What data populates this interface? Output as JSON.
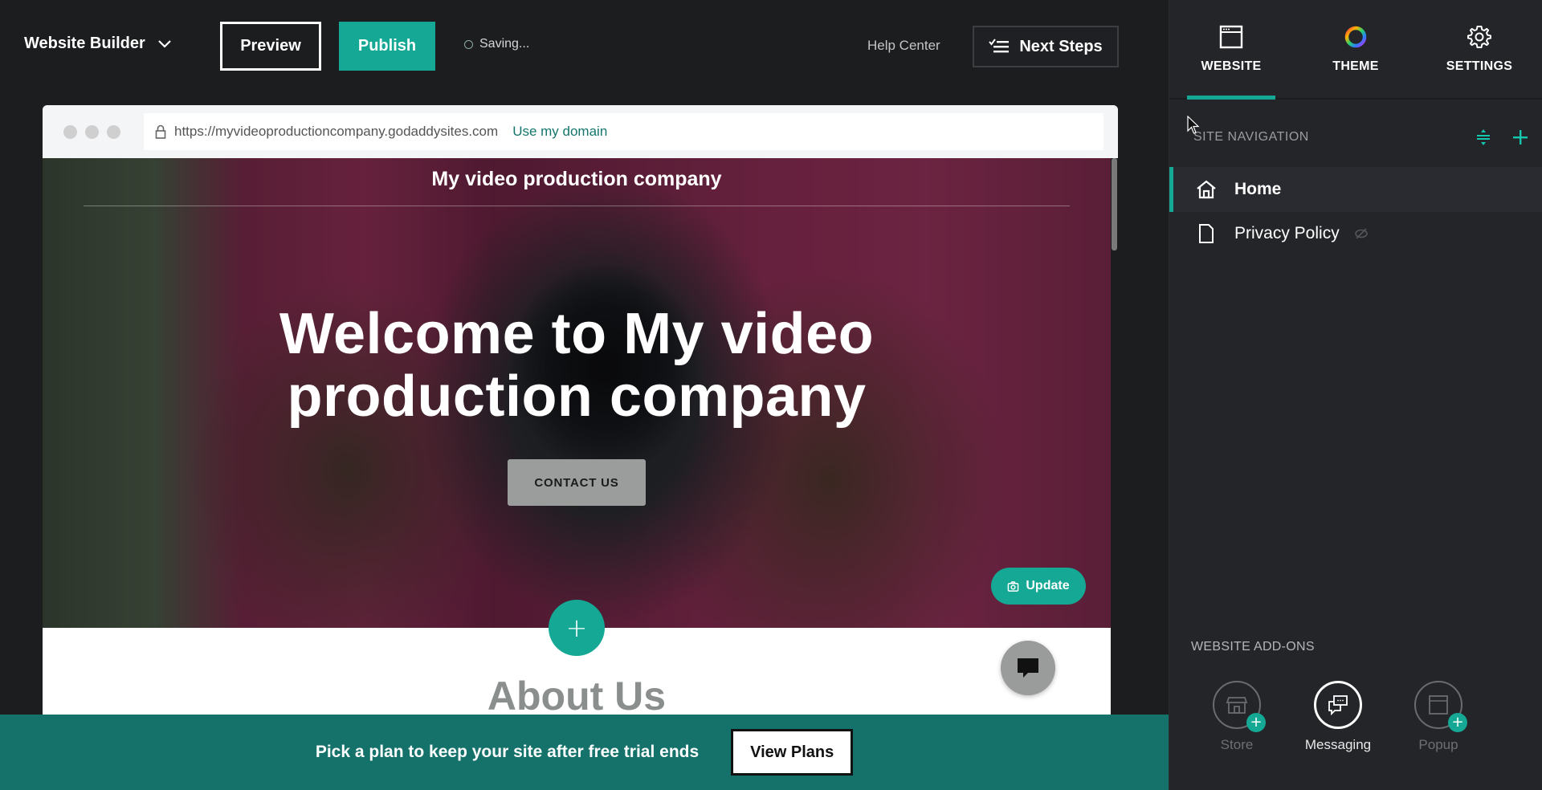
{
  "topbar": {
    "brand_label": "Website Builder",
    "preview_label": "Preview",
    "publish_label": "Publish",
    "status_text": "Saving...",
    "help_label": "Help Center",
    "next_steps_label": "Next Steps"
  },
  "browser": {
    "url": "https://myvideoproductioncompany.godaddysites.com",
    "use_domain_label": "Use my domain"
  },
  "site": {
    "title": "My video production company",
    "hero_heading_line1": "Welcome to My video",
    "hero_heading_line2": "production company",
    "contact_label": "CONTACT US",
    "update_label": "Update",
    "add_section_label": "+",
    "about_title": "About Us"
  },
  "banner": {
    "text": "Pick a plan to keep your site after free trial ends",
    "button_label": "View Plans"
  },
  "sidebar": {
    "tabs": [
      {
        "label": "WEBSITE",
        "icon": "browser-window-icon",
        "active": true
      },
      {
        "label": "THEME",
        "icon": "color-wheel-icon",
        "active": false
      },
      {
        "label": "SETTINGS",
        "icon": "gear-icon",
        "active": false
      }
    ],
    "site_nav_label": "SITE NAVIGATION",
    "pages": [
      {
        "label": "Home",
        "icon": "home-icon",
        "active": true
      },
      {
        "label": "Privacy Policy",
        "icon": "page-icon",
        "hidden": true
      }
    ],
    "addons_label": "WEBSITE ADD-ONS",
    "addons": [
      {
        "label": "Store",
        "icon": "store-icon",
        "enabled": false
      },
      {
        "label": "Messaging",
        "icon": "messaging-icon",
        "enabled": true
      },
      {
        "label": "Popup",
        "icon": "popup-icon",
        "enabled": false
      }
    ]
  },
  "colors": {
    "accent": "#14a895",
    "banner": "#14726b",
    "app_bg": "#1c1d1f",
    "sidebar_bg": "#242529"
  }
}
